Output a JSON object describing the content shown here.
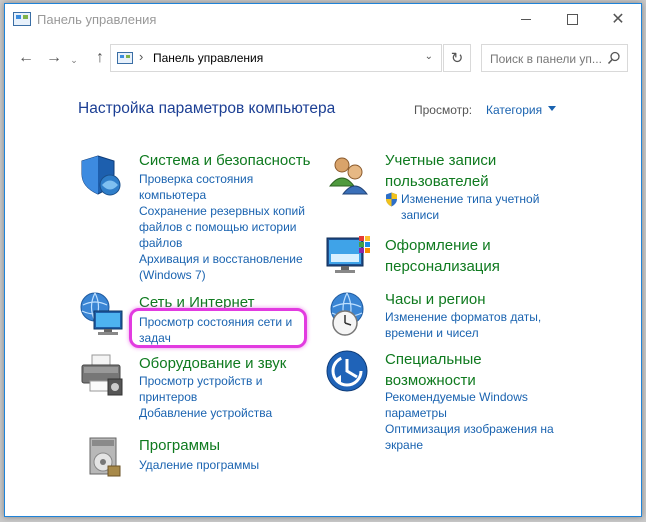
{
  "window": {
    "title": "Панель управления"
  },
  "address": {
    "path": "Панель управления"
  },
  "search": {
    "placeholder": "Поиск в панели уп..."
  },
  "header": {
    "title": "Настройка параметров компьютера",
    "view_label": "Просмотр:",
    "view_value": "Категория"
  },
  "categories": {
    "system": {
      "title": "Система и безопасность",
      "links": [
        "Проверка состояния",
        "компьютера",
        "Сохранение резервных копий",
        "файлов с помощью истории",
        "файлов",
        "Архивация и восстановление",
        "(Windows 7)"
      ]
    },
    "network": {
      "title": "Сеть и Интернет",
      "links": [
        "Просмотр состояния сети и",
        "задач"
      ]
    },
    "hardware": {
      "title": "Оборудование и звук",
      "links": [
        "Просмотр устройств и",
        "принтеров",
        "Добавление устройства"
      ]
    },
    "programs": {
      "title": "Программы",
      "links": [
        "Удаление программы"
      ]
    },
    "accounts": {
      "title_line1": "Учетные записи",
      "title_line2": "пользователей",
      "links": [
        "Изменение типа учетной",
        "записи"
      ]
    },
    "appearance": {
      "title_line1": "Оформление и",
      "title_line2": "персонализация"
    },
    "clock": {
      "title": "Часы и регион",
      "links": [
        "Изменение форматов даты,",
        "времени и чисел"
      ]
    },
    "ease": {
      "title_line1": "Специальные",
      "title_line2": "возможности",
      "links": [
        "Рекомендуемые Windows",
        "параметры",
        "Оптимизация изображения на",
        "экране"
      ]
    }
  },
  "colors": {
    "accent_link": "#1a63b0",
    "category_title": "#0f7a1f",
    "highlight": "#e23be0"
  }
}
